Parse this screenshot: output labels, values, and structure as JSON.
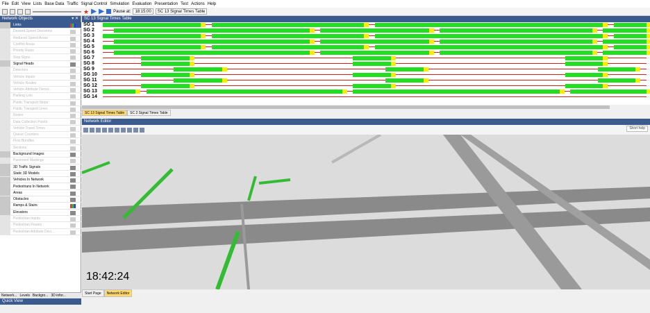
{
  "menu": [
    "File",
    "Edit",
    "View",
    "Lists",
    "Base Data",
    "Traffic",
    "Signal Control",
    "Simulation",
    "Evaluation",
    "Presentation",
    "Test",
    "Actions",
    "Help"
  ],
  "toolbar": {
    "pause_label": "Pause at:",
    "pause_value": "18:15:00",
    "table_select": "SC 13 Signal Times Table"
  },
  "left_panel": {
    "title": "Network Objects",
    "items": [
      {
        "label": "Links",
        "state": "selected"
      },
      {
        "label": "Desired Speed Decisions",
        "state": "dim"
      },
      {
        "label": "Reduced Speed Areas",
        "state": "dim"
      },
      {
        "label": "Conflict Areas",
        "state": "dim"
      },
      {
        "label": "Priority Rules",
        "state": "dim"
      },
      {
        "label": "Stop Signs",
        "state": "dim"
      },
      {
        "label": "Signal Heads",
        "state": "normal"
      },
      {
        "label": "Detectors",
        "state": "dim"
      },
      {
        "label": "Vehicle Inputs",
        "state": "dim"
      },
      {
        "label": "Vehicle Routes",
        "state": "dim"
      },
      {
        "label": "Vehicle Attribute Decisi...",
        "state": "dim"
      },
      {
        "label": "Parking Lots",
        "state": "dim"
      },
      {
        "label": "Public Transport Stops",
        "state": "dim"
      },
      {
        "label": "Public Transport Lines",
        "state": "dim"
      },
      {
        "label": "Nodes",
        "state": "dim"
      },
      {
        "label": "Data Collection Points",
        "state": "dim"
      },
      {
        "label": "Vehicle Travel Times",
        "state": "dim"
      },
      {
        "label": "Queue Counters",
        "state": "dim"
      },
      {
        "label": "Flow Bundles",
        "state": "dim"
      },
      {
        "label": "Sections",
        "state": "dim"
      },
      {
        "label": "Background Images",
        "state": "normal"
      },
      {
        "label": "Pavement Markings",
        "state": "dim"
      },
      {
        "label": "3D Traffic Signals",
        "state": "normal"
      },
      {
        "label": "Static 3D Models",
        "state": "normal"
      },
      {
        "label": "Vehicles In Network",
        "state": "normal"
      },
      {
        "label": "Pedestrians In Network",
        "state": "normal"
      },
      {
        "label": "Areas",
        "state": "normal"
      },
      {
        "label": "Obstacles",
        "state": "normal"
      },
      {
        "label": "Ramps & Stairs",
        "state": "normal"
      },
      {
        "label": "Elevators",
        "state": "normal"
      },
      {
        "label": "Pedestrian Inputs",
        "state": "dim"
      },
      {
        "label": "Pedestrian Routes",
        "state": "dim"
      },
      {
        "label": "Pedestrian Attribute Deci...",
        "state": "dim"
      }
    ],
    "tabs": [
      "Network...",
      "Levels",
      "Backgro...",
      "3D infor..."
    ],
    "quick_view_title": "Quick View"
  },
  "signal_panel": {
    "title": "SC 13 Signal Times Table",
    "rows": [
      {
        "name": "SG 1",
        "green": [
          [
            0,
            18
          ],
          [
            20,
            48
          ],
          [
            50,
            92
          ],
          [
            94,
            100
          ]
        ]
      },
      {
        "name": "SG 2",
        "green": [
          [
            2,
            38
          ],
          [
            40,
            60
          ],
          [
            62,
            90
          ],
          [
            92,
            100
          ]
        ]
      },
      {
        "name": "SG 3",
        "green": [
          [
            0,
            18
          ],
          [
            20,
            48
          ],
          [
            50,
            92
          ],
          [
            94,
            100
          ]
        ]
      },
      {
        "name": "SG 4",
        "green": [
          [
            2,
            38
          ],
          [
            40,
            60
          ],
          [
            62,
            90
          ],
          [
            92,
            100
          ]
        ]
      },
      {
        "name": "SG 5",
        "green": [
          [
            0,
            18
          ],
          [
            20,
            48
          ],
          [
            50,
            92
          ],
          [
            94,
            100
          ]
        ]
      },
      {
        "name": "SG 6",
        "green": [
          [
            2,
            38
          ],
          [
            40,
            60
          ],
          [
            62,
            90
          ],
          [
            92,
            100
          ]
        ]
      },
      {
        "name": "SG 7",
        "green": [
          [
            7,
            16
          ],
          [
            46,
            53
          ],
          [
            85,
            92
          ]
        ]
      },
      {
        "name": "SG 8",
        "green": [
          [
            7,
            16
          ],
          [
            46,
            53
          ],
          [
            85,
            92
          ]
        ]
      },
      {
        "name": "SG 9",
        "green": [
          [
            13,
            22
          ],
          [
            52,
            59
          ],
          [
            91,
            98
          ]
        ]
      },
      {
        "name": "SG 10",
        "green": [
          [
            7,
            16
          ],
          [
            46,
            53
          ],
          [
            85,
            92
          ]
        ]
      },
      {
        "name": "SG 11",
        "green": [
          [
            13,
            22
          ],
          [
            52,
            59
          ],
          [
            91,
            98
          ]
        ]
      },
      {
        "name": "SG 12",
        "green": [
          [
            7,
            16
          ],
          [
            46,
            53
          ],
          [
            85,
            92
          ]
        ]
      },
      {
        "name": "SG 13",
        "green": [
          [
            0,
            6
          ],
          [
            8,
            44
          ],
          [
            46,
            84
          ],
          [
            86,
            100
          ]
        ]
      },
      {
        "name": "SG 14",
        "green": []
      }
    ],
    "tabs": [
      "SC 13 Signal Times Table",
      "SC 2 Signal Times Table"
    ]
  },
  "editor": {
    "title": "Network Editor",
    "shortcut_help": "Short help",
    "clock": "18:42:24",
    "tabs": [
      "Start Page",
      "Network Editor"
    ]
  }
}
